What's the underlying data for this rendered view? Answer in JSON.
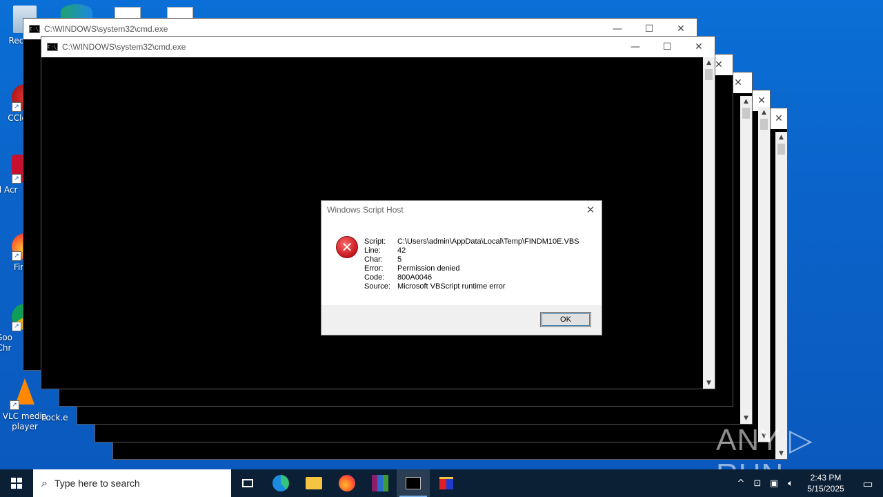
{
  "desktop": {
    "icons": [
      {
        "label": "Recy",
        "icon": "recycle-bin-icon"
      },
      {
        "label": "CCle",
        "icon": "ccleaner-icon"
      },
      {
        "label": "Ad Acr",
        "icon": "adobe-acrobat-icon"
      },
      {
        "label": "Fir",
        "icon": "firefox-icon"
      },
      {
        "label": "Goo Chr",
        "icon": "chrome-icon"
      },
      {
        "label": "VLC media player",
        "icon": "vlc-icon"
      },
      {
        "label": "Lock.e",
        "icon": "file-icon"
      }
    ]
  },
  "cmd_windows": {
    "title": "C:\\WINDOWS\\system32\\cmd.exe",
    "icon_text": "C:\\_",
    "minimize": "—",
    "maximize": "☐",
    "close": "✕",
    "scroll_up": "▲",
    "scroll_down": "▼"
  },
  "dialog": {
    "title": "Windows Script Host",
    "close": "✕",
    "icon": "✕",
    "rows": [
      {
        "key": "Script:",
        "value": "C:\\Users\\admin\\AppData\\Local\\Temp\\FINDM10E.VBS"
      },
      {
        "key": "Line:",
        "value": "42"
      },
      {
        "key": "Char:",
        "value": "5"
      },
      {
        "key": "Error:",
        "value": "Permission denied"
      },
      {
        "key": "Code:",
        "value": "800A0046"
      },
      {
        "key": "Source:",
        "value": "Microsoft VBScript runtime error"
      }
    ],
    "ok_label": "OK"
  },
  "watermark": "ANY ▷ RUN",
  "taskbar": {
    "search_placeholder": "Type here to search",
    "apps": [
      "task-view",
      "edge",
      "file-explorer",
      "firefox",
      "winrar",
      "cmd",
      "app"
    ],
    "time": "2:43 PM",
    "date": "5/15/2025",
    "tray_up": "^",
    "notification": "▭"
  }
}
